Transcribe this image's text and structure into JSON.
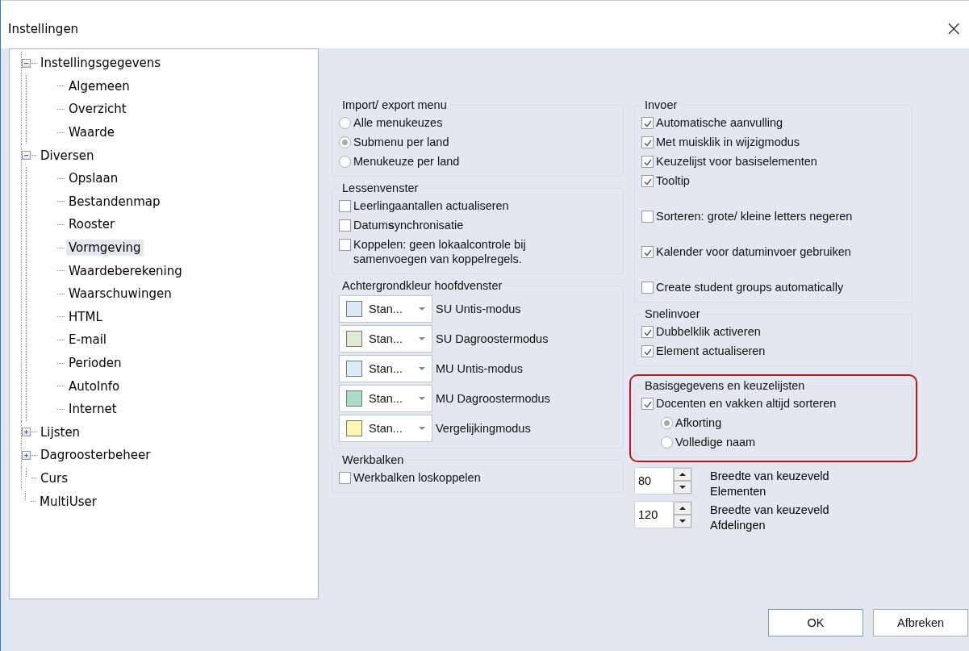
{
  "window": {
    "title": "Instellingen",
    "close": "×"
  },
  "tree": [
    {
      "label": "Instellingsgegevens",
      "expanded": true,
      "selected": false,
      "children": [
        {
          "label": "Algemeen",
          "selected": false
        },
        {
          "label": "Overzicht",
          "selected": false
        },
        {
          "label": "Waarde",
          "selected": false
        }
      ]
    },
    {
      "label": "Diversen",
      "expanded": true,
      "selected": false,
      "children": [
        {
          "label": "Opslaan",
          "selected": false
        },
        {
          "label": "Bestandenmap",
          "selected": false
        },
        {
          "label": "Rooster",
          "selected": false
        },
        {
          "label": "Vormgeving",
          "selected": true
        },
        {
          "label": "Waardeberekening",
          "selected": false
        },
        {
          "label": "Waarschuwingen",
          "selected": false
        },
        {
          "label": "HTML",
          "selected": false
        },
        {
          "label": "E-mail",
          "selected": false
        },
        {
          "label": "Perioden",
          "selected": false
        },
        {
          "label": "AutoInfo",
          "selected": false
        },
        {
          "label": "Internet",
          "selected": false
        }
      ]
    },
    {
      "label": "Lijsten",
      "expanded": false,
      "selected": false
    },
    {
      "label": "Dagroosterbeheer",
      "expanded": false,
      "selected": false
    },
    {
      "label": "Curs",
      "selected": false
    },
    {
      "label": "MultiUser",
      "selected": false
    }
  ],
  "left_groups": [
    {
      "title": "Import/ export menu",
      "items": [
        {
          "kind": "radio",
          "label": "Alle menukeuzes",
          "selected": false
        },
        {
          "kind": "radio",
          "label": "Submenu per land",
          "selected": true
        },
        {
          "kind": "radio",
          "label": "Menukeuze per land",
          "selected": false
        }
      ]
    },
    {
      "title": "Lessenvenster",
      "items": [
        {
          "kind": "checkbox",
          "label": "Leerlingaantallen actualiseren",
          "checked": false
        },
        {
          "kind": "checkbox",
          "label": "Datum**s**ynchronisatie",
          "checked": false
        },
        {
          "kind": "checkbox",
          "label": "Koppelen: geen lokaalcontrole bij samenvoegen van koppelregels.",
          "checked": false
        }
      ]
    },
    {
      "title": "Achtergrondkleur hoofdvenster",
      "items": [
        {
          "kind": "color",
          "value": "Stan...",
          "label": "SU Untis-modus",
          "color": "#dde6f4"
        },
        {
          "kind": "color",
          "value": "Stan...",
          "label": "SU Dagroostermodus",
          "color": "#dcebd0"
        },
        {
          "kind": "color",
          "value": "Stan...",
          "label": "MU Untis-modus",
          "color": "#dcecfa"
        },
        {
          "kind": "color",
          "value": "Stan...",
          "label": "MU Dagroostermodus",
          "color": "#acdcc8"
        },
        {
          "kind": "color",
          "value": "Stan...",
          "label": "Vergelijkingmodus",
          "color": "#fbf6b0"
        }
      ]
    },
    {
      "title": "Werkbalken",
      "items": [
        {
          "kind": "checkbox",
          "label": "Werkbalken loskoppelen",
          "checked": false
        }
      ]
    }
  ],
  "right_groups": [
    {
      "title": "Invoer",
      "highlighted": false,
      "items": [
        {
          "kind": "checkbox",
          "label": "Automatische aanvulling",
          "checked": true
        },
        {
          "kind": "checkbox",
          "label": "Met muisklik in wijzigmodus",
          "checked": true
        },
        {
          "kind": "checkbox",
          "label": "Keuzelijst voor basiselementen",
          "checked": true
        },
        {
          "kind": "checkbox",
          "label": "Tooltip",
          "checked": true
        },
        {
          "kind": "checkbox",
          "label": "Sorteren: grote/ kleine letters negeren",
          "checked": false
        },
        {
          "kind": "checkbox",
          "label": "Kalender voor datuminvoer gebruiken",
          "checked": true
        },
        {
          "kind": "checkbox",
          "label": "Create student groups automatically",
          "checked": false
        }
      ]
    },
    {
      "title": "Snelinvoer",
      "highlighted": false,
      "items": [
        {
          "kind": "checkbox",
          "label": "Dubbelklik activeren",
          "checked": true
        },
        {
          "kind": "checkbox",
          "label": "Element actualiseren",
          "checked": true
        }
      ]
    },
    {
      "title": "Basisgegevens en keuzelijsten",
      "highlighted": true,
      "items": [
        {
          "kind": "checkbox",
          "label": "Docenten en vakken altijd sorteren",
          "checked": true
        },
        {
          "kind": "subradio",
          "label": "Afkorting",
          "selected": true
        },
        {
          "kind": "subradio",
          "label": "Volledige naam",
          "selected": false
        }
      ]
    }
  ],
  "spinners": [
    {
      "value": "80",
      "label": "Breedte van keuzeveld Elementen"
    },
    {
      "value": "120",
      "label": "Breedte van keuzeveld Afdelingen"
    }
  ],
  "buttons": [
    "OK",
    "Afbreken"
  ]
}
